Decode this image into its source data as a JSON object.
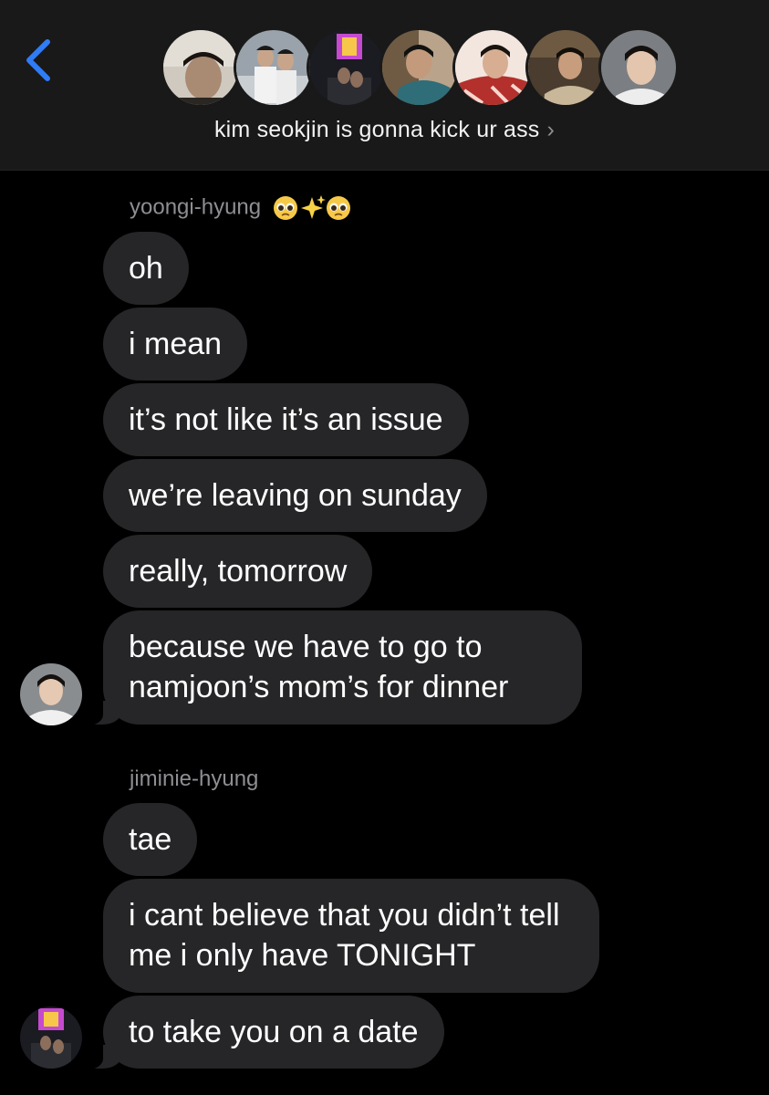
{
  "header": {
    "group_title": "kim seokjin is gonna kick ur ass",
    "chevron": "›",
    "back_icon": "chevron-left-icon",
    "accent": "#2f7cf6",
    "participants": [
      "avatar-1",
      "avatar-2",
      "avatar-3",
      "avatar-4",
      "avatar-5",
      "avatar-6",
      "avatar-7"
    ]
  },
  "thread": {
    "groups": [
      {
        "sender": "yoongi-hyung",
        "sender_emoji": [
          "pleading-face",
          "sparkles",
          "pleading-face"
        ],
        "messages": [
          "oh",
          "i mean",
          "it’s not like it’s an issue",
          "we’re leaving on sunday",
          "really, tomorrow",
          "because we have to go to namjoon’s mom’s for dinner"
        ]
      },
      {
        "sender": "jiminie-hyung",
        "messages": [
          "tae",
          "i cant believe that you didn’t tell me i only have TONIGHT",
          "to take you on a date"
        ]
      }
    ]
  },
  "colors": {
    "bubble": "#262628",
    "background": "#000000",
    "header_bg": "#191919",
    "sender_text": "#8e8e93"
  }
}
